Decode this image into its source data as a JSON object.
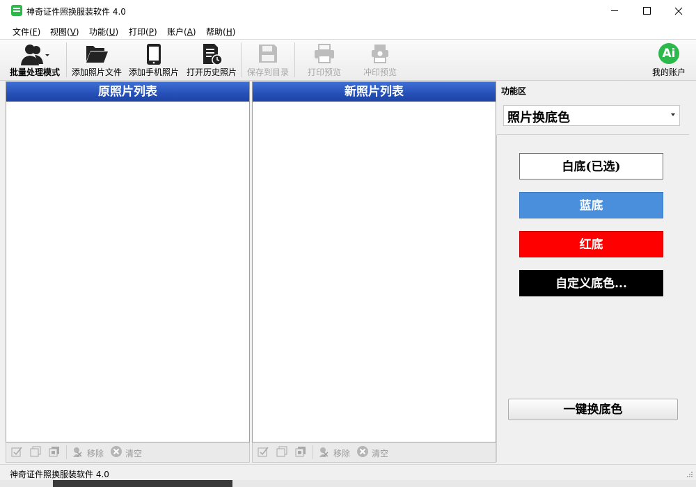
{
  "window": {
    "title": "神奇证件照换服装软件 4.0",
    "icon": "app-icon"
  },
  "menu": {
    "items": [
      {
        "label": "文件",
        "key": "F"
      },
      {
        "label": "视图",
        "key": "V"
      },
      {
        "label": "功能",
        "key": "U"
      },
      {
        "label": "打印",
        "key": "P"
      },
      {
        "label": "账户",
        "key": "A"
      },
      {
        "label": "帮助",
        "key": "H"
      }
    ]
  },
  "toolbar": {
    "batch": "批量处理模式",
    "add_photo": "添加照片文件",
    "add_phone": "添加手机照片",
    "open_history": "打开历史照片",
    "save_to_dir": "保存到目录",
    "print_preview": "打印预览",
    "develop_preview": "冲印预览",
    "my_account": "我的账户",
    "account_badge": "Ai"
  },
  "panels": {
    "original_title": "原照片列表",
    "new_title": "新照片列表",
    "remove_label": "移除",
    "clear_label": "清空"
  },
  "function_area": {
    "title": "功能区",
    "selected_function": "照片换底色",
    "buttons": {
      "white": "白底(已选)",
      "blue": "蓝底",
      "red": "红底",
      "custom": "自定义底色..."
    },
    "one_click": "一键换底色",
    "colors": {
      "blue": "#4a8fdc",
      "red": "#ff0000",
      "black": "#000000",
      "header_blue": "#2650b8"
    }
  },
  "status": {
    "text": "神奇证件照换服装软件 4.0"
  }
}
